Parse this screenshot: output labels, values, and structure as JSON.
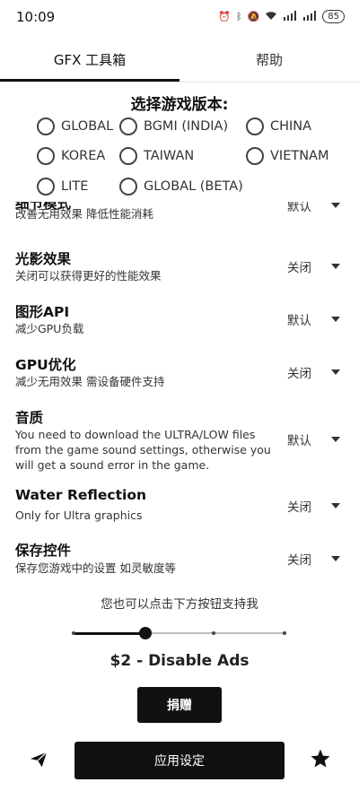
{
  "status_bar": {
    "time": "10:09",
    "battery": "85"
  },
  "tabs": [
    {
      "label": "GFX 工具箱"
    },
    {
      "label": "帮助"
    }
  ],
  "version": {
    "title": "选择游戏版本:",
    "options": [
      "GLOBAL",
      "BGMI (INDIA)",
      "CHINA",
      "KOREA",
      "TAIWAN",
      "VIETNAM",
      "LITE",
      "GLOBAL (BETA)"
    ]
  },
  "settings": [
    {
      "title": "细节模式",
      "desc": "改善无用效果 降低性能消耗",
      "value": "默认"
    },
    {
      "title": "光影效果",
      "desc": "关闭可以获得更好的性能效果",
      "value": "关闭"
    },
    {
      "title": "图形API",
      "desc": "减少GPU负载",
      "value": "默认"
    },
    {
      "title": "GPU优化",
      "desc": "减少无用效果 需设备硬件支持",
      "value": "关闭"
    },
    {
      "title": "音质",
      "desc_lines": [
        "You need to download the ULTRA/LOW files",
        "from the game sound settings, otherwise you",
        "will get a sound error in the game."
      ],
      "value": "默认"
    },
    {
      "title": "Water Reflection",
      "desc": "Only for Ultra graphics",
      "value": "关闭"
    },
    {
      "title": "保存控件",
      "desc": "保存您游戏中的设置 如灵敏度等",
      "value": "关闭"
    }
  ],
  "support": {
    "text": "您也可以点击下方按钮支持我",
    "price": "$2 - Disable Ads",
    "slider_level": 0.33,
    "donate_label": "捐赠"
  },
  "bottom": {
    "apply_label": "应用设定",
    "left_icon": "send-icon",
    "right_icon": "star-icon"
  }
}
